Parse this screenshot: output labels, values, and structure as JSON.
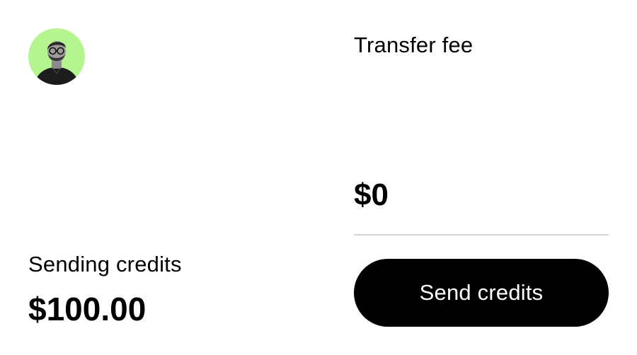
{
  "avatar": {
    "icon": "user-avatar-photo",
    "background": "#b5f58f"
  },
  "transfer_fee": {
    "label": "Transfer fee",
    "amount": "$0"
  },
  "sending": {
    "label": "Sending credits",
    "amount": "$100.00"
  },
  "actions": {
    "send_label": "Send credits"
  },
  "colors": {
    "button_bg": "#000000",
    "button_text": "#ffffff",
    "divider": "#d3d3d3",
    "avatar_bg": "#b5f58f"
  }
}
